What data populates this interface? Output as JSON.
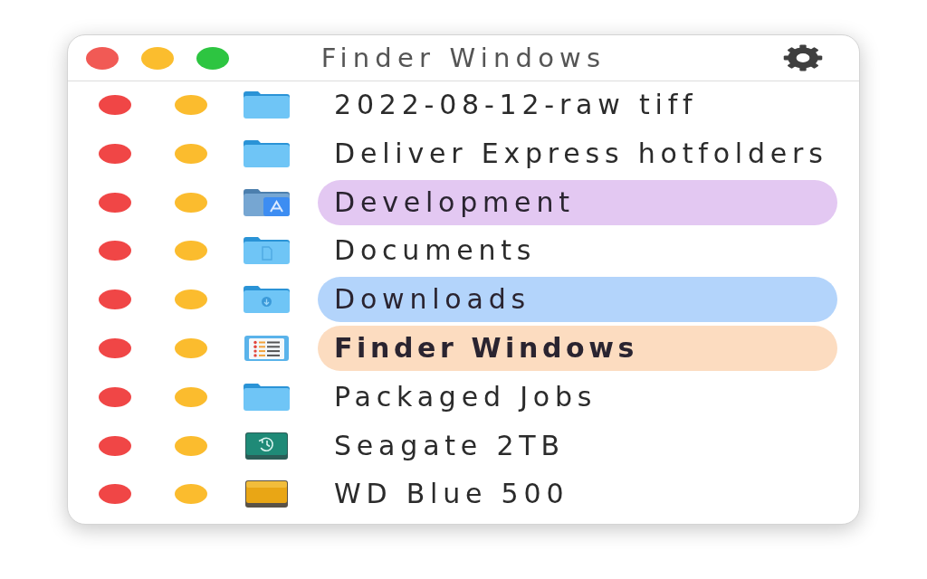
{
  "window": {
    "title": "Finder Windows"
  },
  "items": [
    {
      "name": "2022-08-12-raw tiff",
      "kind": "folder",
      "active": false
    },
    {
      "name": "Deliver Express hotfolders",
      "kind": "folder",
      "active": false
    },
    {
      "name": "Development",
      "kind": "apps",
      "active": false,
      "color": "#e3c8f2"
    },
    {
      "name": "Documents",
      "kind": "documents",
      "active": false
    },
    {
      "name": "Downloads",
      "kind": "downloads",
      "active": false,
      "color": "#b3d4fb"
    },
    {
      "name": "Finder Windows",
      "kind": "list",
      "active": true,
      "color": "#fcdcc0"
    },
    {
      "name": "Packaged Jobs",
      "kind": "folder",
      "active": false
    },
    {
      "name": "Seagate 2TB",
      "kind": "backup",
      "active": false
    },
    {
      "name": "WD Blue 500",
      "kind": "disk",
      "active": false
    }
  ]
}
